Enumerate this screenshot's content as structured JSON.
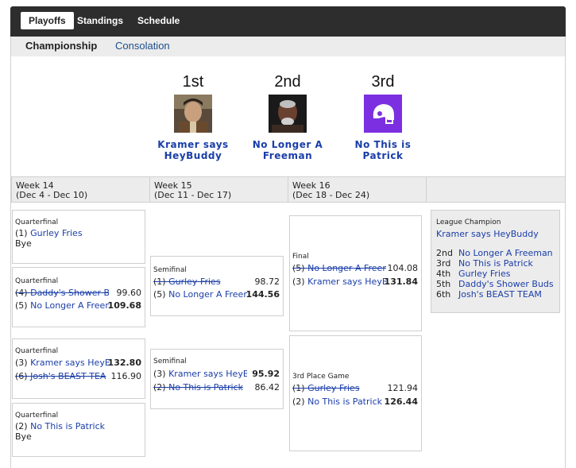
{
  "nav": {
    "tabs": [
      {
        "label": "Playoffs"
      },
      {
        "label": "Standings"
      },
      {
        "label": "Schedule"
      }
    ]
  },
  "subnav": {
    "tabs": [
      {
        "label": "Championship"
      },
      {
        "label": "Consolation"
      }
    ]
  },
  "podium": [
    {
      "place": "1st",
      "team_line1": "Kramer says",
      "team_line2": "HeyBuddy",
      "avatar": "kramer-photo"
    },
    {
      "place": "2nd",
      "team_line1": "No Longer A",
      "team_line2": "Freeman",
      "avatar": "freeman-photo"
    },
    {
      "place": "3rd",
      "team_line1": "No This is Patrick",
      "team_line2": "",
      "avatar": "helmet-icon"
    }
  ],
  "weeks": [
    {
      "name": "Week 14",
      "range": "(Dec 4 - Dec 10)"
    },
    {
      "name": "Week 15",
      "range": "(Dec 11 - Dec 17)"
    },
    {
      "name": "Week 16",
      "range": "(Dec 18 - Dec 24)"
    },
    {
      "name": "",
      "range": ""
    }
  ],
  "week14": [
    {
      "label": "Quarterfinal",
      "team1": {
        "seed": "(1)",
        "name": "Gurley Fries",
        "score": "",
        "lost": false
      },
      "bye": "Bye"
    },
    {
      "label": "Quarterfinal",
      "team1": {
        "seed": "(4)",
        "name": "Daddy's Shower Bu",
        "score": "99.60",
        "lost": true
      },
      "team2": {
        "seed": "(5)",
        "name": "No Longer A Freem",
        "score": "109.68",
        "lost": false
      }
    },
    {
      "label": "Quarterfinal",
      "team1": {
        "seed": "(3)",
        "name": "Kramer says HeyBu",
        "score": "132.80",
        "lost": false
      },
      "team2": {
        "seed": "(6)",
        "name": "Josh's BEAST TEA",
        "score": "116.90",
        "lost": true
      }
    },
    {
      "label": "Quarterfinal",
      "team1": {
        "seed": "(2)",
        "name": "No This is Patrick",
        "score": "",
        "lost": false
      },
      "bye": "Bye"
    }
  ],
  "week15": [
    {
      "label": "Semifinal",
      "team1": {
        "seed": "(1)",
        "name": "Gurley Fries",
        "score": "98.72",
        "lost": true
      },
      "team2": {
        "seed": "(5)",
        "name": "No Longer A Freem",
        "score": "144.56",
        "lost": false
      }
    },
    {
      "label": "Semifinal",
      "team1": {
        "seed": "(3)",
        "name": "Kramer says HeyBu",
        "score": "95.92",
        "lost": false
      },
      "team2": {
        "seed": "(2)",
        "name": "No This is Patrick",
        "score": "86.42",
        "lost": true
      }
    }
  ],
  "week16": [
    {
      "label": "Final",
      "team1": {
        "seed": "(5)",
        "name": "No Longer A Freem",
        "score": "104.08",
        "lost": true
      },
      "team2": {
        "seed": "(3)",
        "name": "Kramer says HeyBu",
        "score": "131.84",
        "lost": false
      }
    },
    {
      "label": "3rd Place Game",
      "team1": {
        "seed": "(1)",
        "name": "Gurley Fries",
        "score": "121.94",
        "lost": true
      },
      "team2": {
        "seed": "(2)",
        "name": "No This is Patrick",
        "score": "126.44",
        "lost": false
      }
    }
  ],
  "champion": {
    "label": "League Champion",
    "name": "Kramer says HeyBuddy",
    "finishes": [
      {
        "place": "2nd",
        "name": "No Longer A Freeman"
      },
      {
        "place": "3rd",
        "name": "No This is Patrick"
      },
      {
        "place": "4th",
        "name": "Gurley Fries"
      },
      {
        "place": "5th",
        "name": "Daddy's Shower Buds"
      },
      {
        "place": "6th",
        "name": "Josh's BEAST TEAM"
      }
    ]
  },
  "colors": {
    "link": "#1a3ea8",
    "topbar": "#2d2d2d",
    "panel": "#ececec",
    "helmet": "#7b2fe0"
  }
}
